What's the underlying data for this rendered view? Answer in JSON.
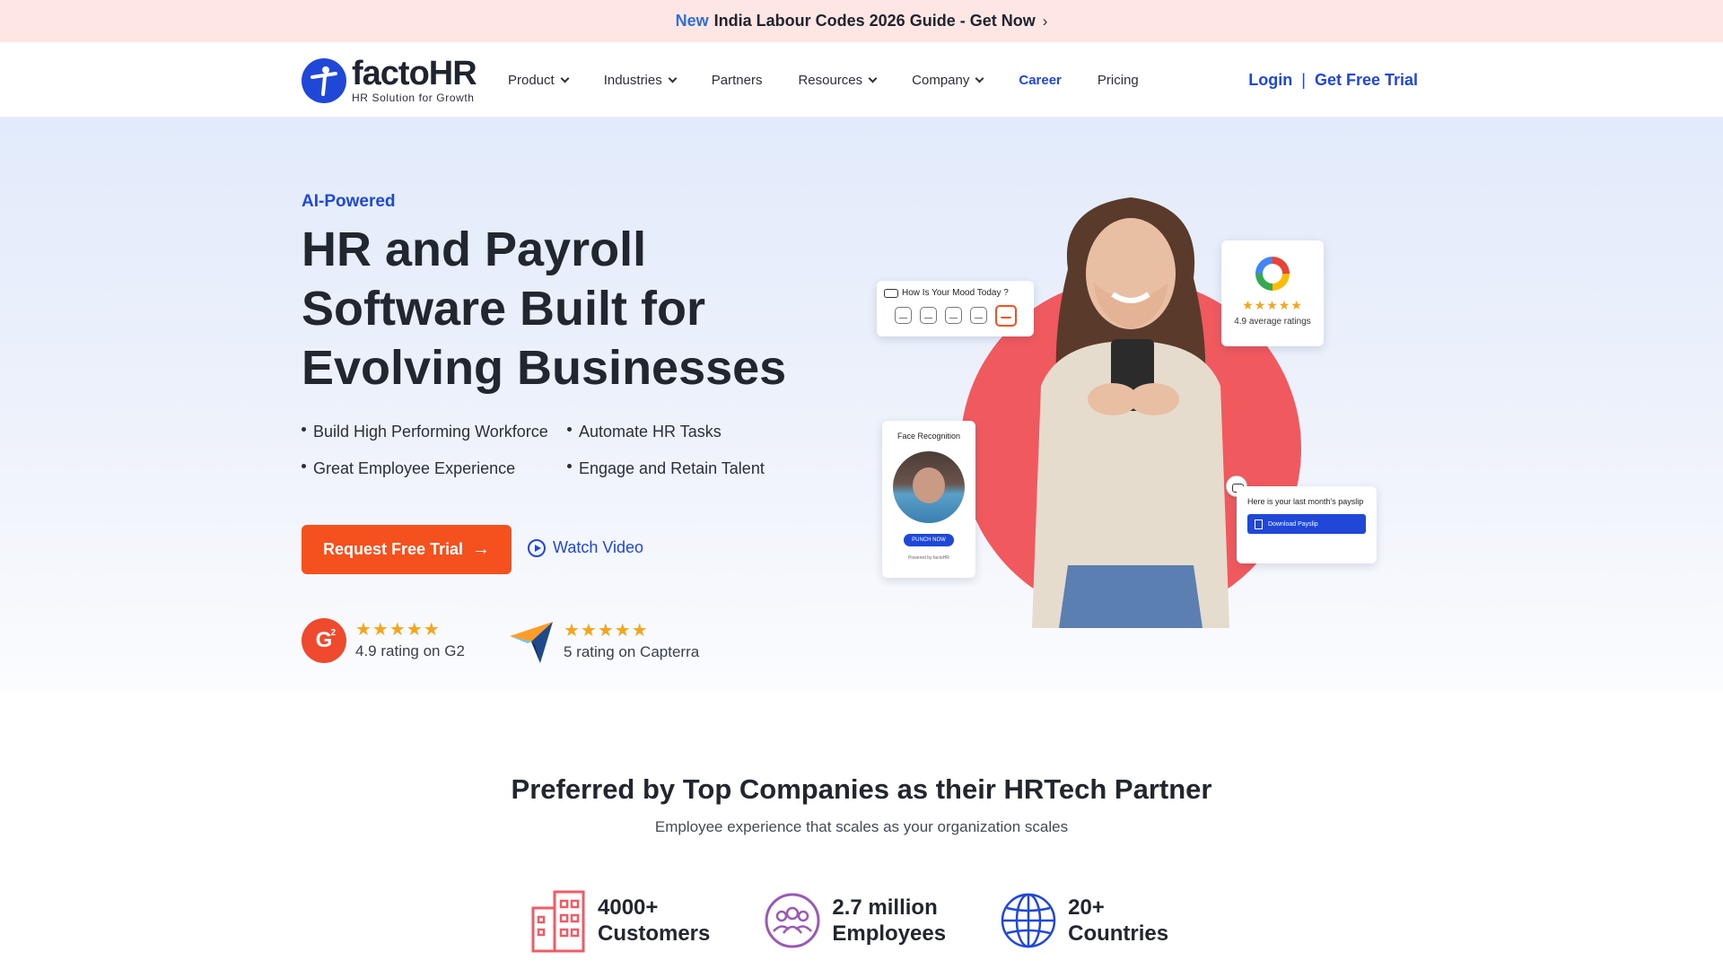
{
  "announcement": {
    "new_label": "New",
    "text": "India Labour Codes 2026 Guide - Get Now",
    "chevron": "›"
  },
  "header": {
    "logo_name": "factoHR",
    "logo_tagline": "HR Solution for Growth",
    "nav": [
      {
        "label": "Product",
        "has_caret": true
      },
      {
        "label": "Industries",
        "has_caret": true
      },
      {
        "label": "Partners",
        "has_caret": false
      },
      {
        "label": "Resources",
        "has_caret": true
      },
      {
        "label": "Company",
        "has_caret": true
      },
      {
        "label": "Career",
        "has_caret": false
      },
      {
        "label": "Pricing",
        "has_caret": false
      }
    ],
    "login": "Login",
    "separator": "|",
    "free_trial": "Get Free Trial"
  },
  "hero": {
    "eyebrow": "AI-Powered",
    "headline": "HR and Payroll Software Built for Evolving Businesses",
    "bullets": [
      "Build High Performing Workforce",
      "Automate HR Tasks",
      "Great Employee Experience",
      "Engage and Retain Talent"
    ],
    "cta_label": "Request Free Trial",
    "cta_arrow": "→",
    "watch_label": "Watch Video",
    "ratings": [
      {
        "source": "G2",
        "stars": "★★★★★",
        "text": "4.9 rating on G2",
        "value": 4.9
      },
      {
        "source": "Capterra",
        "stars": "★★★★★",
        "text": "5 rating on Capterra",
        "value": 5
      }
    ]
  },
  "visual": {
    "mood_title": "How Is Your Mood Today ?",
    "google_stars": "★★★★★",
    "google_text": "4.9 average ratings",
    "face_title": "Face Recognition",
    "punch_label": "PUNCH NOW",
    "powered_label": "Powered by factoHR",
    "payslip_text": "Here is your last month's payslip",
    "payslip_button": "Download Payslip"
  },
  "preferred": {
    "title": "Preferred by Top Companies as their HRTech Partner",
    "subtitle": "Employee experience that scales as your organization scales",
    "stats": [
      {
        "value": "4000+",
        "label": "Customers",
        "icon": "building-icon"
      },
      {
        "value": "2.7 million",
        "label": "Employees",
        "icon": "people-icon"
      },
      {
        "value": "20+",
        "label": "Countries",
        "icon": "globe-icon"
      }
    ]
  },
  "colors": {
    "brand_blue": "#1f47d8",
    "cta_orange": "#f4511e",
    "star_gold": "#f5a51b",
    "circle_coral": "#f05a5f",
    "announce_bg": "#fde6e3"
  }
}
